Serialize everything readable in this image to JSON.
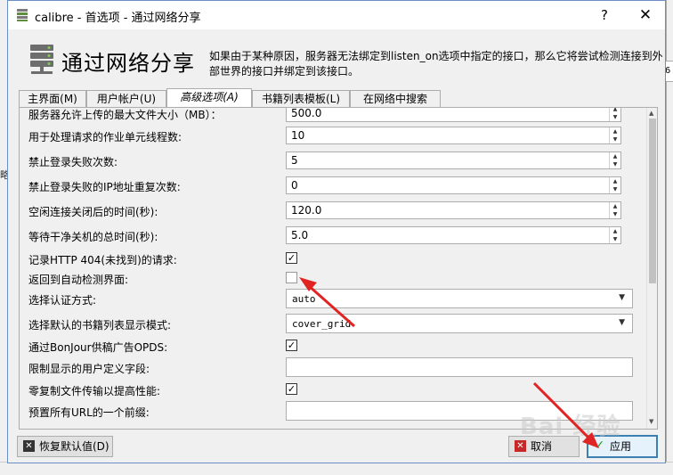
{
  "window": {
    "title": "calibre - 首选项 - 通过网络分享",
    "help_glyph": "?",
    "close_glyph": "✕"
  },
  "header": {
    "title": "通过网络分享",
    "description": "如果由于某种原因，服务器无法绑定到listen_on选项中指定的接口，那么它将尝试检测连接到外部世界的接口并绑定到该接口。"
  },
  "tabs": [
    {
      "label": "主界面(M)"
    },
    {
      "label": "用户帐户(U)"
    },
    {
      "label": "高级选项(A)",
      "active": true
    },
    {
      "label": "书籍列表模板(L)"
    },
    {
      "label": "在网络中搜索"
    }
  ],
  "settings": {
    "max_upload": {
      "label": "服务器允许上传的最大文件大小（MB）：",
      "value": "500.0"
    },
    "worker_threads": {
      "label": "用于处理请求的作业单元线程数:",
      "value": "10"
    },
    "ban_after": {
      "label": "禁止登录失败次数:",
      "value": "5"
    },
    "ban_repeat": {
      "label": "禁止登录失败的IP地址重复次数:",
      "value": "0"
    },
    "idle_timeout": {
      "label": "空闲连接关闭后的时间(秒):",
      "value": "120.0"
    },
    "shutdown_timeout": {
      "label": "等待干净关机的总时间(秒):",
      "value": "5.0"
    },
    "log_404": {
      "label": "记录HTTP 404(未找到)的请求:",
      "checked": true
    },
    "fallback_autodetect": {
      "label": "返回到自动检测界面:",
      "checked": false
    },
    "auth_method": {
      "label": "选择认证方式:",
      "value": "auto"
    },
    "book_list_mode": {
      "label": "选择默认的书籍列表显示模式:",
      "value": "cover_grid"
    },
    "bonjour": {
      "label": "通过BonJour供稿广告OPDS:",
      "checked": true
    },
    "restrict_fields": {
      "label": "限制显示的用户定义字段:",
      "value": ""
    },
    "zero_copy": {
      "label": "零复制文件传输以提高性能:",
      "checked": true
    },
    "url_prefix": {
      "label": "预置所有URL的一个前缀:",
      "value": ""
    }
  },
  "glyphs": {
    "check": "✓",
    "spin_up": "▲",
    "spin_down": "▼",
    "dropdown": "▼"
  },
  "buttons": {
    "restore_defaults": "恢复默认值(D)",
    "cancel": "取消",
    "apply": "应用"
  },
  "background": {
    "left_fragment": "略",
    "right_fragment": "6"
  },
  "watermark": {
    "text": "Bai 经验"
  },
  "colors": {
    "annotation_red": "#e02424",
    "accent_blue": "#3c7fb1",
    "apply_green": "#1f9d2a",
    "cancel_red": "#c62828"
  }
}
